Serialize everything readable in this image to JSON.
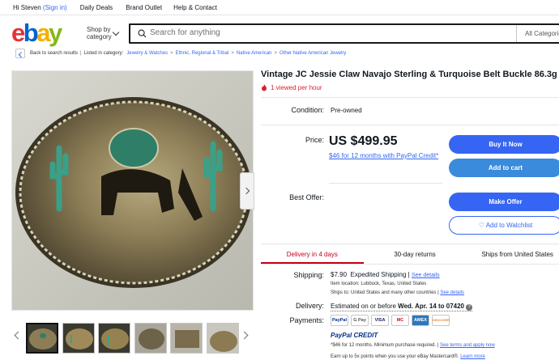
{
  "topbar": {
    "greeting": "Hi Steven",
    "sign_in": "(Sign in)",
    "links": [
      "Daily Deals",
      "Brand Outlet",
      "Help & Contact"
    ]
  },
  "header": {
    "logo": {
      "e": "e",
      "b": "b",
      "a": "a",
      "y": "y"
    },
    "shop_by_line1": "Shop by",
    "shop_by_line2": "category",
    "search_placeholder": "Search for anything",
    "category_select": "All Categories"
  },
  "breadcrumb": {
    "back": "Back to search results",
    "listed_in": "Listed in category:",
    "items": [
      "Jewelry & Watches",
      "Ethnic, Regional & Tribal",
      "Native American",
      "Other Native American Jewelry"
    ]
  },
  "item": {
    "title": "Vintage JC Jessie Claw Navajo Sterling & Turquoise Belt Buckle 86.3g",
    "viewed": "1 viewed per hour",
    "condition_label": "Condition:",
    "condition_value": "Pre-owned",
    "price_label": "Price:",
    "price": "US $499.95",
    "financing": "$46 for 12 months with PayPal Credit*",
    "best_offer_label": "Best Offer:"
  },
  "buttons": {
    "buy_now": "Buy It Now",
    "add_to_cart": "Add to cart",
    "make_offer": "Make Offer",
    "watchlist": "Add to Watchlist"
  },
  "tabs": [
    "Delivery in 4 days",
    "30-day returns",
    "Ships from United States"
  ],
  "shipping": {
    "label": "Shipping:",
    "cost": "$7.90",
    "method": "Expedited Shipping",
    "see_details": "See details",
    "location": "Item location:  Lubbock, Texas, United States",
    "ships_to": "Ships to:  United States and many other countries",
    "see_details2": "See details"
  },
  "delivery": {
    "label": "Delivery:",
    "text": "Estimated on or before",
    "date": "Wed. Apr. 14 to 07420"
  },
  "payments": {
    "label": "Payments:",
    "icons": [
      "PayPal",
      "G Pay",
      "VISA",
      "MC",
      "AMEX",
      "DISCOVER"
    ],
    "credit_brand": "PayPal CREDIT",
    "credit_terms": "*$46 for 12 months. Minimum purchase required.",
    "terms_link": "See terms and apply now",
    "earn": "Earn up to 5x points when you use your eBay Mastercard®.",
    "learn": "Learn more"
  },
  "colors": {
    "accent": "#3665f3",
    "alert": "#dd1e31",
    "active_tab": "#c40018"
  }
}
